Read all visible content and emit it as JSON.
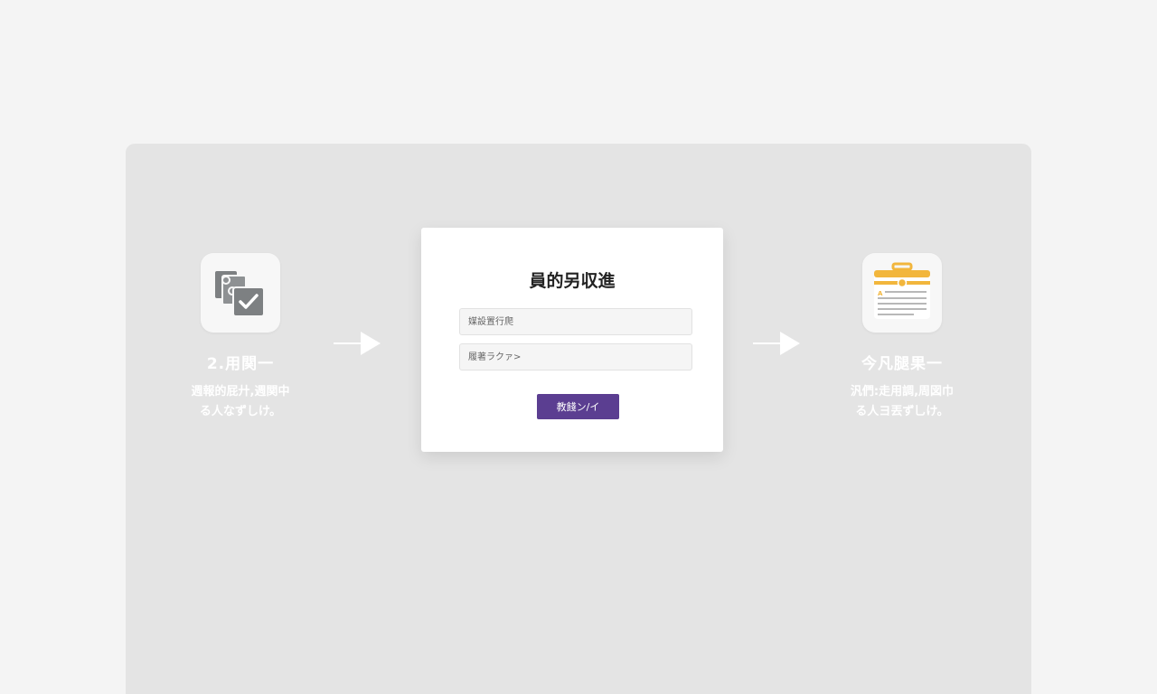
{
  "left_step": {
    "icon": "checklist-documents-icon",
    "title": "2.用関一",
    "desc_line1": "週報的屁廾,週関中",
    "desc_line2": "る人なずしけ。"
  },
  "form": {
    "title": "員的另収進",
    "field1_placeholder": "媒設置行爬",
    "field2_placeholder": "履著ラクァ>",
    "submit_label": "教餞ン/イ"
  },
  "right_step": {
    "icon": "toolbox-document-icon",
    "title": "今凡腿果一",
    "desc_line1": "汎們:走用調,周図巾",
    "desc_line2": "る人ヨ丟ず乚け。"
  },
  "colors": {
    "accent": "#5b3e91",
    "icon_gray": "#7d8082",
    "icon_yellow": "#f2b63c"
  }
}
